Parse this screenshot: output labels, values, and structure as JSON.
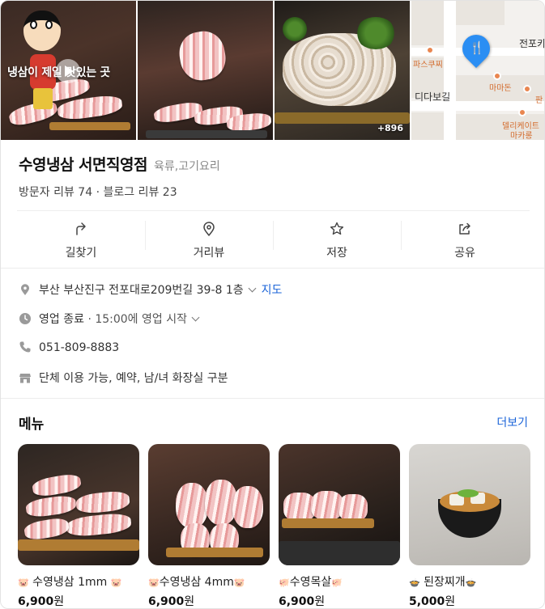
{
  "photos": {
    "video_overlay_text": "냉삼이 제일 맛있는 곳",
    "more_count": "+896",
    "map": {
      "labels": [
        "전포카",
        "파스쿠찌",
        "마마돈",
        "디다보길",
        "판",
        "델리케이트",
        "마카롱"
      ]
    }
  },
  "place": {
    "name": "수영냉삼 서면직영점",
    "category": "육류,고기요리",
    "visitor_reviews": "방문자 리뷰 74",
    "separator": "·",
    "blog_reviews": "블로그 리뷰 23"
  },
  "actions": [
    {
      "label": "길찾기",
      "icon": "directions-icon"
    },
    {
      "label": "거리뷰",
      "icon": "street-view-icon"
    },
    {
      "label": "저장",
      "icon": "star-icon"
    },
    {
      "label": "공유",
      "icon": "share-icon"
    }
  ],
  "info": {
    "address": "부산 부산진구 전포대로209번길 39-8 1층",
    "map_link": "지도",
    "status": "영업 종료",
    "status_detail": "· 15:00에 영업 시작",
    "phone": "051-809-8883",
    "amenities": "단체 이용 가능, 예약, 남/녀 화장실 구분"
  },
  "menu": {
    "title": "메뉴",
    "more": "더보기",
    "items": [
      {
        "name": "수영냉삼 1mm",
        "price": "6,900",
        "unit": "원",
        "badge": "🐷"
      },
      {
        "name": "수영냉삼 4mm",
        "price": "6,900",
        "unit": "원",
        "badge": "🐷"
      },
      {
        "name": "수영목살",
        "price": "6,900",
        "unit": "원",
        "badge": "🐖"
      },
      {
        "name": "된장찌개",
        "price": "5,000",
        "unit": "원",
        "badge": "🍲"
      }
    ]
  },
  "colors": {
    "accent_link": "#1a63d8",
    "map_pin": "#2b8ef3",
    "text_primary": "#111111"
  }
}
